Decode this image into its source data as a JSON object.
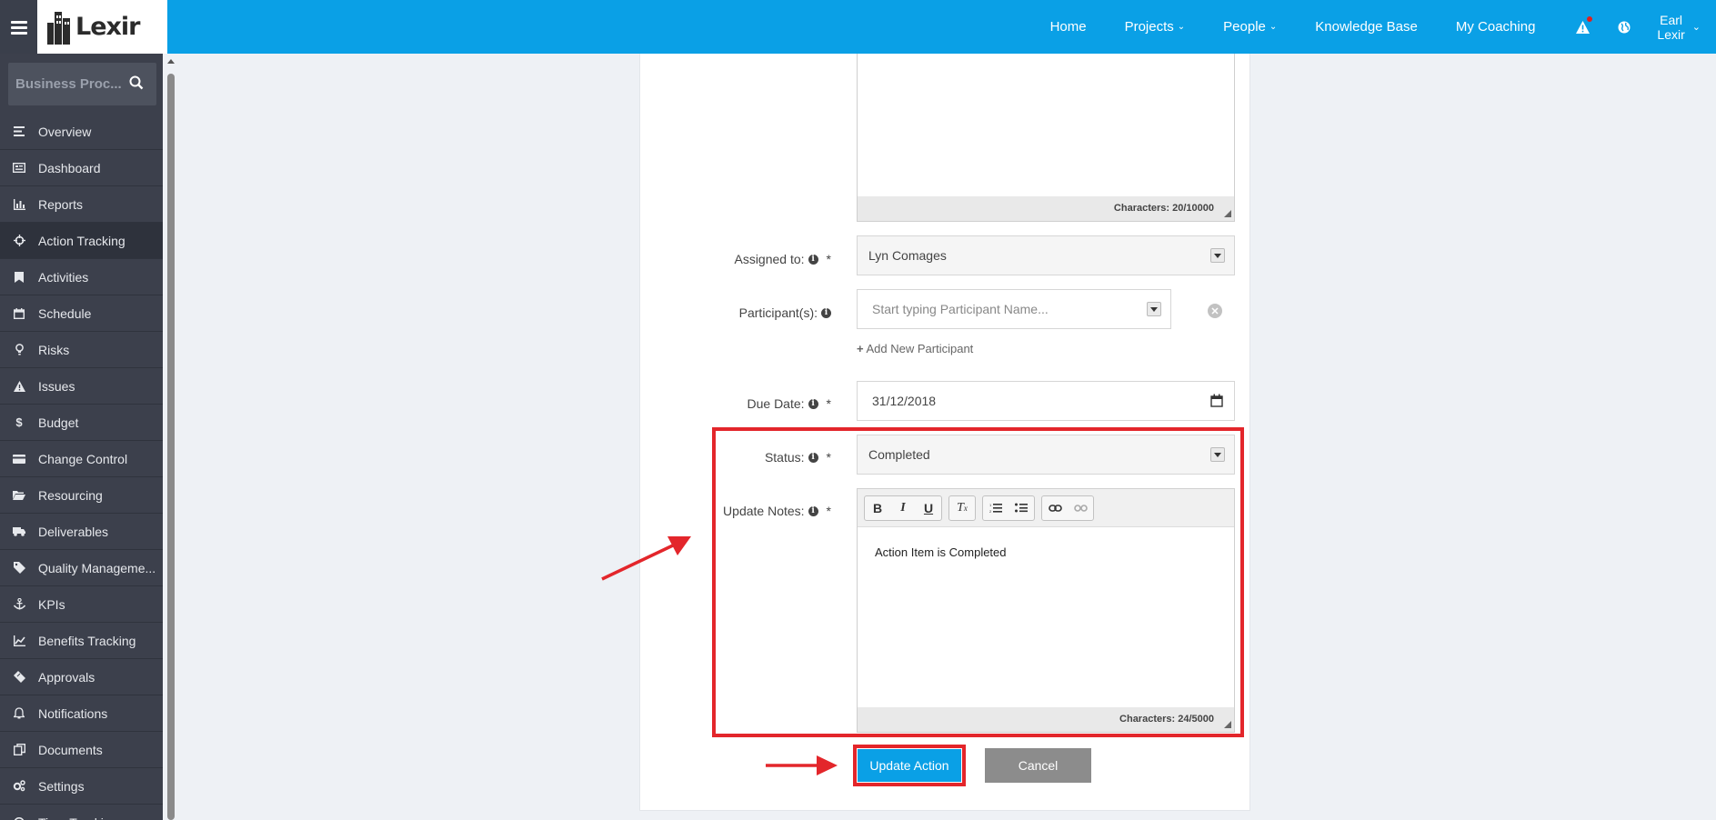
{
  "header": {
    "brand": "Lexir",
    "nav": [
      {
        "label": "Home",
        "dropdown": false
      },
      {
        "label": "Projects",
        "dropdown": true
      },
      {
        "label": "People",
        "dropdown": true
      },
      {
        "label": "Knowledge Base",
        "dropdown": false
      },
      {
        "label": "My Coaching",
        "dropdown": false
      }
    ],
    "user_first": "Earl",
    "user_last": "Lexir"
  },
  "sidebar": {
    "search_text": "Business Proc...",
    "items": [
      {
        "label": "Overview",
        "icon": "overview-icon"
      },
      {
        "label": "Dashboard",
        "icon": "dashboard-icon"
      },
      {
        "label": "Reports",
        "icon": "bar-chart-icon"
      },
      {
        "label": "Action Tracking",
        "icon": "crosshair-icon",
        "active": true
      },
      {
        "label": "Activities",
        "icon": "bookmark-icon"
      },
      {
        "label": "Schedule",
        "icon": "calendar-icon"
      },
      {
        "label": "Risks",
        "icon": "lightbulb-icon"
      },
      {
        "label": "Issues",
        "icon": "warning-icon"
      },
      {
        "label": "Budget",
        "icon": "dollar-icon"
      },
      {
        "label": "Change Control",
        "icon": "card-icon"
      },
      {
        "label": "Resourcing",
        "icon": "folder-open-icon"
      },
      {
        "label": "Deliverables",
        "icon": "truck-icon"
      },
      {
        "label": "Quality Manageme...",
        "icon": "tag-icon"
      },
      {
        "label": "KPIs",
        "icon": "anchor-icon"
      },
      {
        "label": "Benefits Tracking",
        "icon": "line-chart-icon"
      },
      {
        "label": "Approvals",
        "icon": "ticket-icon"
      },
      {
        "label": "Notifications",
        "icon": "bell-icon"
      },
      {
        "label": "Documents",
        "icon": "copy-icon"
      },
      {
        "label": "Settings",
        "icon": "cogs-icon"
      },
      {
        "label": "Time Tracking",
        "icon": "clock-icon"
      }
    ]
  },
  "form": {
    "description_chars": "Characters: 20/10000",
    "assigned_label": "Assigned to:",
    "assigned_value": "Lyn Comages",
    "participants_label": "Participant(s):",
    "participants_placeholder": "Start typing Participant Name...",
    "add_participant": "Add New Participant",
    "due_label": "Due Date:",
    "due_value": "31/12/2018",
    "status_label": "Status:",
    "status_value": "Completed",
    "notes_label": "Update Notes:",
    "notes_value": "Action Item is Completed",
    "notes_chars": "Characters: 24/5000",
    "required_mark": "*",
    "update_button": "Update Action",
    "cancel_button": "Cancel"
  },
  "colors": {
    "primary": "#0aa0e6",
    "sidebar": "#3c404c",
    "highlight": "#e3262b"
  }
}
